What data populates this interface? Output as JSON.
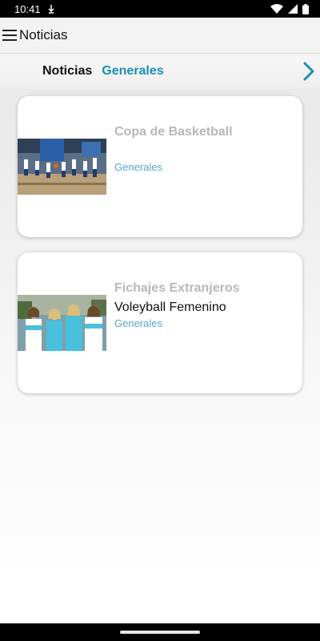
{
  "status_bar": {
    "time": "10:41",
    "icons": [
      "signal-arrow-icon",
      "wifi-icon",
      "cellular-icon",
      "battery-icon"
    ]
  },
  "app_bar": {
    "title": "Noticias",
    "menu_icon": "menu-icon"
  },
  "tabs": [
    {
      "label": "Noticias",
      "color": "#111111"
    },
    {
      "label": "Generales",
      "color": "#1a8fb5"
    }
  ],
  "news": [
    {
      "title": "Copa de Basketball",
      "subtitle": "",
      "category": "Generales",
      "image": "basketball-photo"
    },
    {
      "title": "Fichajes Extranjeros",
      "subtitle": "Voleyball Femenino",
      "category": "Generales",
      "image": "volleyball-team-photo"
    }
  ],
  "colors": {
    "accent": "#1a8fb5",
    "category": "#5aa7c7",
    "card_title": "#b8b8b8"
  }
}
